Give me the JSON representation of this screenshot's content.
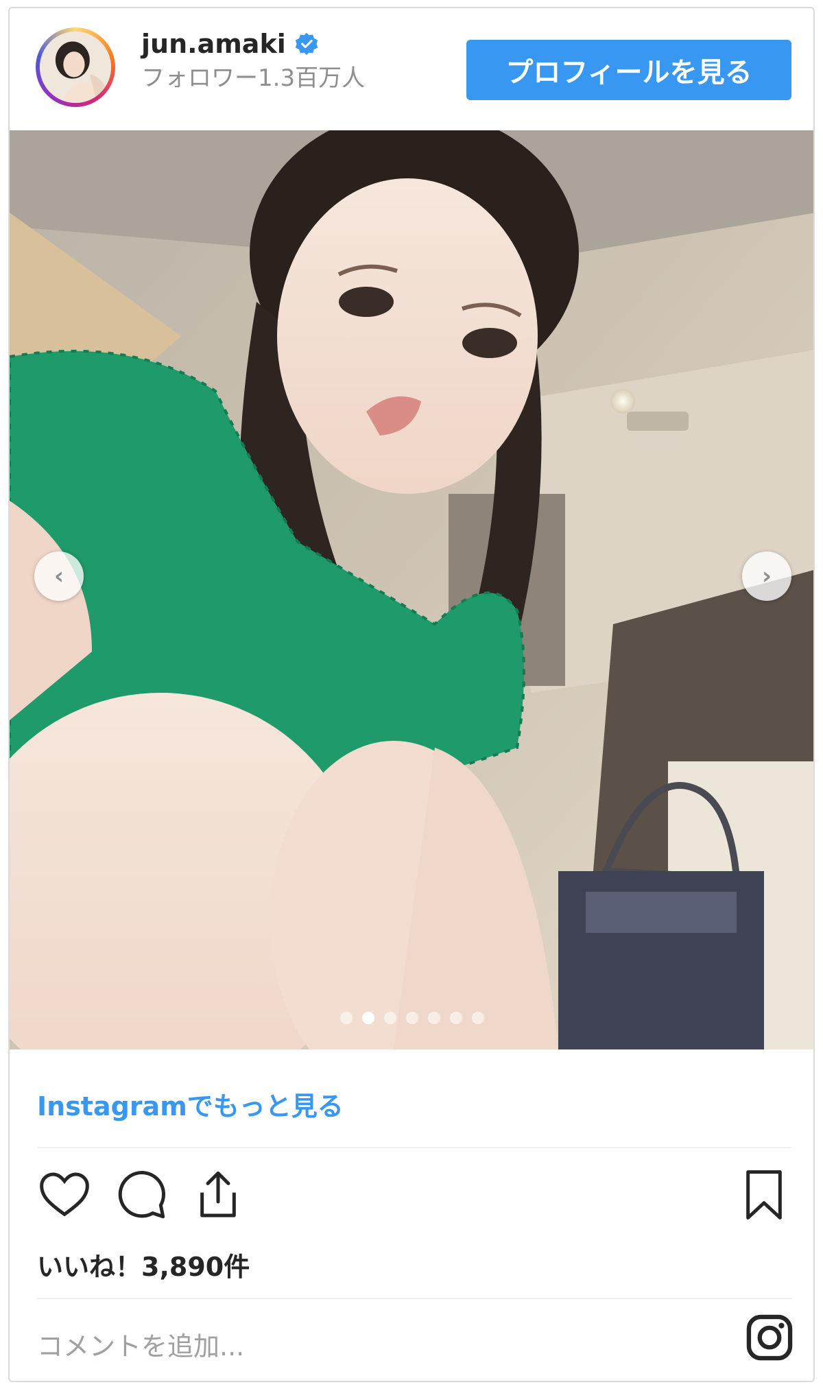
{
  "header": {
    "username": "jun.amaki",
    "followers": "フォロワー1.3百万人",
    "profile_button_label": "プロフィールを見る"
  },
  "media": {
    "carousel_prev_icon": "chevron-left-icon",
    "carousel_next_icon": "chevron-right-icon",
    "carousel_total": 7,
    "carousel_active_index": 1
  },
  "footer": {
    "more_link": "Instagramでもっと見る",
    "likes": "いいね！3,890件",
    "comment_placeholder": "コメントを追加..."
  },
  "icons": {
    "like": "heart-icon",
    "comment": "comment-icon",
    "share": "share-icon",
    "save": "bookmark-icon",
    "brand": "instagram-logo-icon",
    "verified": "verified-badge-icon"
  },
  "colors": {
    "accent": "#3897f0",
    "text": "#262626",
    "muted": "#8e8e8e",
    "border": "#dbdbdb"
  }
}
